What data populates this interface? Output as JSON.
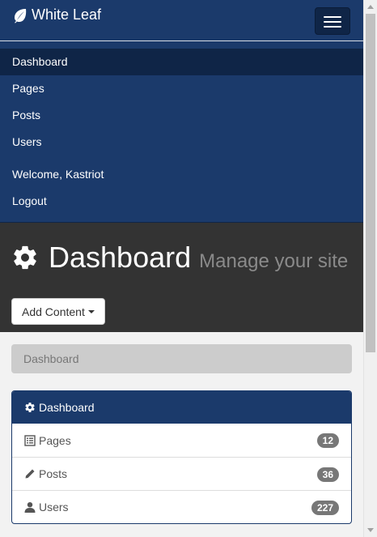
{
  "navbar": {
    "brand": "White Leaf",
    "items": [
      {
        "label": "Dashboard",
        "active": true
      },
      {
        "label": "Pages"
      },
      {
        "label": "Posts"
      },
      {
        "label": "Users"
      }
    ],
    "right_items": [
      {
        "label": "Welcome, Kastriot"
      },
      {
        "label": "Logout"
      }
    ]
  },
  "header": {
    "title": "Dashboard",
    "subtitle": "Manage your site",
    "add_button_label": "Add Content"
  },
  "breadcrumb": {
    "current": "Dashboard"
  },
  "panel": {
    "heading": "Dashboard",
    "items": [
      {
        "label": "Pages",
        "count": "12",
        "icon": "list-icon"
      },
      {
        "label": "Posts",
        "count": "36",
        "icon": "pencil-icon"
      },
      {
        "label": "Users",
        "count": "227",
        "icon": "user-icon"
      }
    ]
  },
  "colors": {
    "navbar_bg": "#1b3a6b",
    "navbar_active": "#0f2547",
    "header_bg": "#333333",
    "breadcrumb_bg": "#cccccc",
    "badge_bg": "#777777"
  }
}
